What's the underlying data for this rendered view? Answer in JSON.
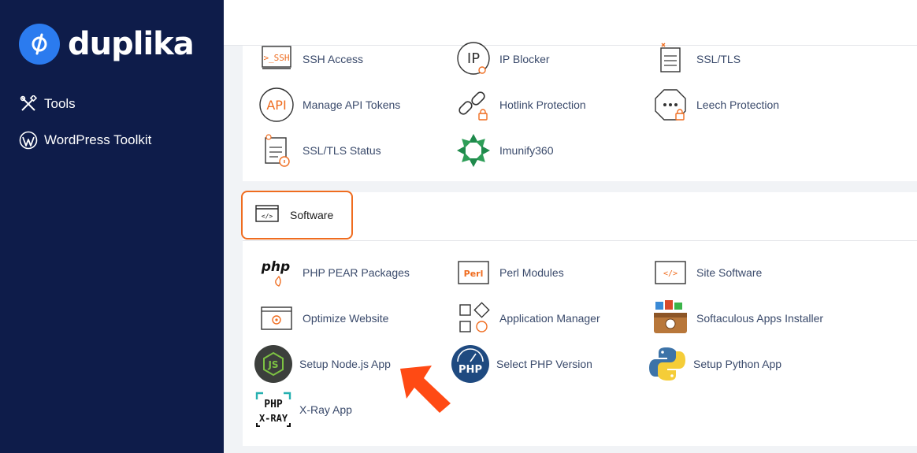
{
  "brand": {
    "name": "duplika"
  },
  "sidebar": {
    "items": [
      {
        "label": "Tools"
      },
      {
        "label": "WordPress Toolkit"
      }
    ]
  },
  "security": {
    "items": [
      {
        "label": "SSH Access",
        "icon": "ssh-terminal-icon"
      },
      {
        "label": "IP Blocker",
        "icon": "ip-blocker-icon"
      },
      {
        "label": "SSL/TLS",
        "icon": "ssl-certificate-icon"
      },
      {
        "label": "Manage API Tokens",
        "icon": "api-tokens-icon"
      },
      {
        "label": "Hotlink Protection",
        "icon": "hotlink-chain-icon"
      },
      {
        "label": "Leech Protection",
        "icon": "leech-protection-icon"
      },
      {
        "label": "SSL/TLS Status",
        "icon": "ssl-status-icon"
      },
      {
        "label": "Imunify360",
        "icon": "imunify360-icon"
      }
    ],
    "ssh_badge": ">_SSH",
    "ip_badge": "IP",
    "api_badge": "API"
  },
  "software": {
    "title": "Software",
    "items": [
      {
        "label": "PHP PEAR Packages",
        "icon": "php-pear-icon"
      },
      {
        "label": "Perl Modules",
        "icon": "perl-icon"
      },
      {
        "label": "Site Software",
        "icon": "site-software-icon"
      },
      {
        "label": "Optimize Website",
        "icon": "optimize-website-icon"
      },
      {
        "label": "Application Manager",
        "icon": "application-manager-icon"
      },
      {
        "label": "Softaculous Apps Installer",
        "icon": "softaculous-icon"
      },
      {
        "label": "Setup Node.js App",
        "icon": "nodejs-icon"
      },
      {
        "label": "Select PHP Version",
        "icon": "php-version-icon"
      },
      {
        "label": "Setup Python App",
        "icon": "python-icon"
      },
      {
        "label": "X-Ray App",
        "icon": "xray-icon"
      }
    ],
    "php_badge": "php",
    "perl_badge": "Perl",
    "code_badge": "</>",
    "php_version_badge": "PHP",
    "xray_badge_top": "PHP",
    "xray_badge_bottom": "X-RAY"
  },
  "colors": {
    "sidebar_bg": "#0e1c4a",
    "accent": "#ef6c1f",
    "brand_blue": "#2b7bef",
    "label_text": "#3a4a6b"
  }
}
